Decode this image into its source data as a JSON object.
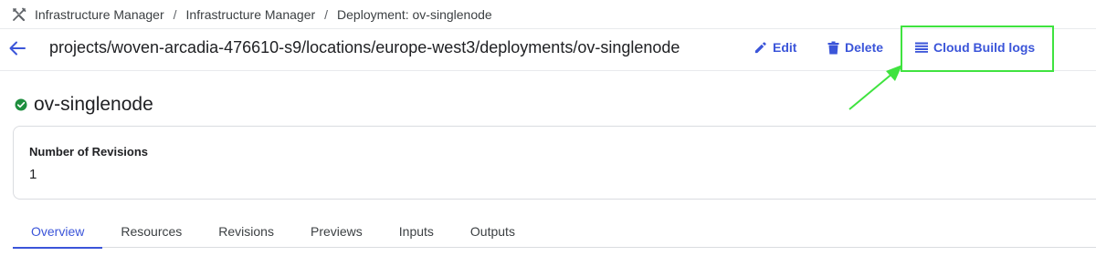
{
  "breadcrumb": {
    "icon": "infrastructure-manager-icon",
    "items": [
      "Infrastructure Manager",
      "Infrastructure Manager",
      "Deployment: ov-singlenode"
    ],
    "separator": "/"
  },
  "header": {
    "path": "projects/woven-arcadia-476610-s9/locations/europe-west3/deployments/ov-singlenode",
    "actions": {
      "edit_label": "Edit",
      "delete_label": "Delete",
      "logs_label": "Cloud Build logs"
    }
  },
  "deployment": {
    "name": "ov-singlenode",
    "status_icon": "check-circle-icon",
    "status_color": "#1e8e3e"
  },
  "card": {
    "label": "Number of Revisions",
    "value": "1"
  },
  "tabs": [
    {
      "label": "Overview",
      "active": true
    },
    {
      "label": "Resources"
    },
    {
      "label": "Revisions"
    },
    {
      "label": "Previews"
    },
    {
      "label": "Inputs"
    },
    {
      "label": "Outputs"
    }
  ],
  "colors": {
    "accent": "#3b55d9",
    "highlight": "#3fe33f"
  }
}
